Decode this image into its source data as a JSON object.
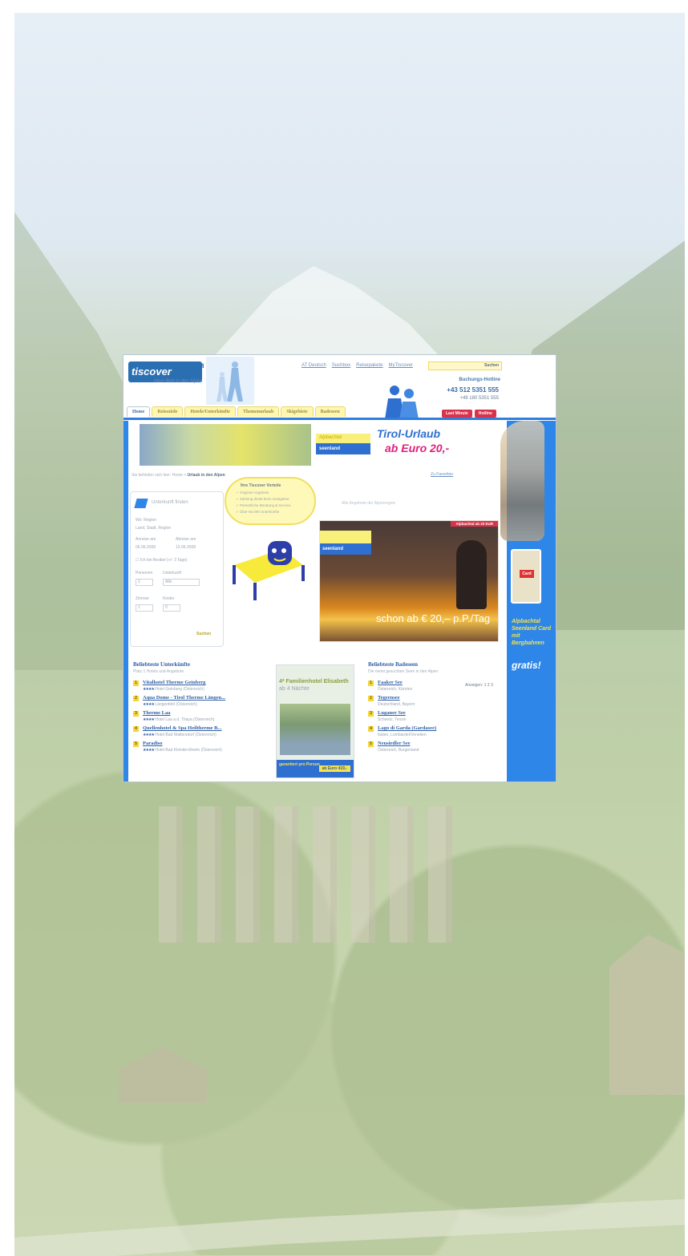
{
  "site": {
    "logo": "tiscover",
    "logo_suffix": "com",
    "slogan": "Mein Bett in den Alpen"
  },
  "header": {
    "toplinks": [
      "AT Deutsch",
      "Suchbox",
      "Reisepakete",
      "MyTiscover"
    ],
    "search_button": "Suchen",
    "hotline_label": "Buchungs-Hotline",
    "phone_1": "+43 512 5351 555",
    "phone_2": "+49 180 5351 555"
  },
  "tabs": [
    "Home",
    "Reiseziele",
    "Hotels/Unterkünfte",
    "Themenurlaub",
    "Skigebiete",
    "Badeseen"
  ],
  "red_tabs": [
    "Last Minute",
    "Hotline"
  ],
  "banner": {
    "seenland_top": "Alpbachtal",
    "seenland": "seenland",
    "title": "Tirol-Urlaub",
    "subtitle": "ab Euro 20,-"
  },
  "breadcrumb": {
    "prefix": "Sie befinden sich hier: Home >",
    "current": "Urlaub in den Alpen"
  },
  "fav_link": "Zu Favoriten",
  "searchbox": {
    "title": "Unterkunft finden",
    "region_label": "Wo: Region",
    "region_value": "Land, Stadt, Region",
    "arrival_label": "Anreise am",
    "departure_label": "Abreise am",
    "arrival_value": "06.06.2008",
    "departure_value": "13.06.2008",
    "flex": "Ich bin flexibel (+/- 3 Tage)",
    "persons_label": "Personen",
    "category_label": "Unterkunft",
    "persons_value": "2",
    "category_value": "Alle",
    "rooms_label": "Zimmer",
    "kids_label": "Kinder",
    "rooms_value": "1",
    "kids_value": "0",
    "submit": "Suchen"
  },
  "bubble": {
    "title": "Ihre Tiscover Vorteile",
    "items": [
      "Original-Angebote",
      "Zahlung direkt beim Gastgeber",
      "Persönliche Beratung & Service",
      "Über 65.000 Unterkünfte"
    ]
  },
  "vote_text": "Alle Angebote der Alpenregion",
  "promo": {
    "header": "Alpbachtal ab 20 EUR",
    "seenland": "seenland",
    "price": "schon ab € 20,– p.P./Tag"
  },
  "unterkuenfte": {
    "title": "Beliebteste Unterkünfte",
    "subtitle": "Platz 1 Hotels und Angebote",
    "items": [
      {
        "n": "1",
        "name": "Vitalhotel Therme Geinberg",
        "stars": "★★★★",
        "desc": "Hotel Geinberg (Österreich)"
      },
      {
        "n": "2",
        "name": "Aqua Dome - Tirol Therme Längen...",
        "stars": "★★★★",
        "desc": "Längenfeld (Österreich)"
      },
      {
        "n": "3",
        "name": "Therme Laa",
        "stars": "★★★★",
        "desc": "Hotel Laa a.d. Thaya (Österreich)"
      },
      {
        "n": "4",
        "name": "Quellenhotel & Spa Heiltherme B...",
        "stars": "★★★★",
        "desc": "Hotel Bad Waltersdorf (Österreich)"
      },
      {
        "n": "5",
        "name": "Paradiso",
        "stars": "★★★★",
        "desc": "Hotel Bad Kleinkirchheim (Österreich)"
      }
    ]
  },
  "ad": {
    "headline": "4* Familienhotel Elisabeth",
    "sub": "ab 4 Nächte",
    "footer_left": "garantiert pro Person",
    "footer_price": "ab Euro 419,-"
  },
  "badeseen": {
    "title": "Beliebteste Badeseen",
    "subtitle": "Die meist gesuchten Seen in den Alpen",
    "side_label": "Anzeigen: 1 2 3",
    "items": [
      {
        "n": "1",
        "name": "Faaker See",
        "desc": "Österreich, Kärnten"
      },
      {
        "n": "2",
        "name": "Tegernsee",
        "desc": "Deutschland, Bayern"
      },
      {
        "n": "3",
        "name": "Luganer See",
        "desc": "Schweiz, Tessin"
      },
      {
        "n": "4",
        "name": "Lago di Garda (Gardasee)",
        "desc": "Italien, Lombardei/Venetien"
      },
      {
        "n": "5",
        "name": "Neusiedler See",
        "desc": "Österreich, Burgenland"
      }
    ]
  },
  "right_col": {
    "card_label": "Card",
    "text": "Alpbachtal Seenland Card mit Bergbahnen",
    "gratis": "gratis!"
  }
}
